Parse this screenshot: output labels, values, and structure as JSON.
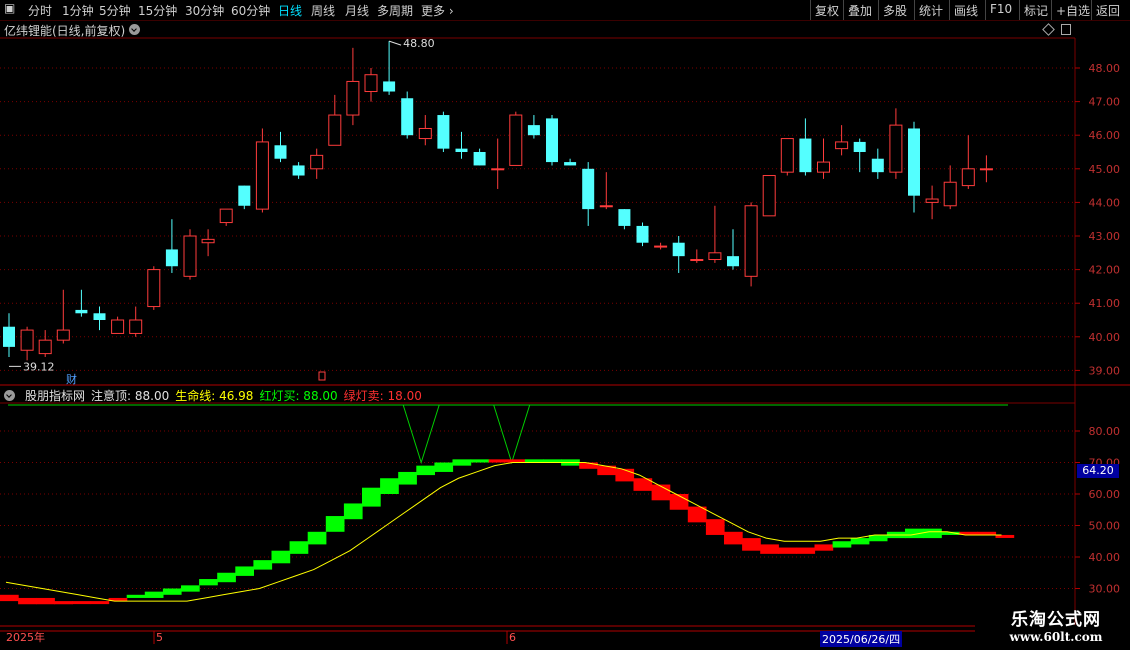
{
  "toolbar": {
    "left": [
      "分时",
      "1分钟",
      "5分钟",
      "15分钟",
      "30分钟",
      "60分钟",
      "日线",
      "周线",
      "月线",
      "多周期",
      "更多"
    ],
    "active": "日线",
    "right": [
      "复权",
      "叠加",
      "多股",
      "统计",
      "画线",
      "F10",
      "标记",
      "+自选",
      "返回"
    ]
  },
  "stock": {
    "title": "亿纬锂能(日线,前复权)",
    "high_marker": "48.80",
    "low_marker": "39.12",
    "fin_marker": "财"
  },
  "price_axis": [
    "48.00",
    "47.00",
    "46.00",
    "45.00",
    "44.00",
    "43.00",
    "42.00",
    "41.00",
    "40.00",
    "39.00"
  ],
  "indicator": {
    "name": "股朋指标网",
    "items": [
      {
        "label": "注意顶: 88.00",
        "color": "#e0e0e0"
      },
      {
        "label": "生命线: 46.98",
        "color": "#ffff00"
      },
      {
        "label": "红灯买: 88.00",
        "color": "#00ff00"
      },
      {
        "label": "绿灯卖: 18.00",
        "color": "#ff3030"
      }
    ],
    "axis": [
      "80.00",
      "70.00",
      "60.00",
      "50.00",
      "40.00",
      "30.00"
    ],
    "current_label": "64.20"
  },
  "date_axis": {
    "year": "2025年",
    "m5": "5",
    "m6": "6",
    "cursor_date": "2025/06/26/四"
  },
  "watermark": {
    "line1": "乐淘公式网",
    "line2": "www.60lt.com"
  },
  "colors": {
    "up": "#ff3c3c",
    "down": "#54ffff",
    "green": "#00ff00",
    "red": "#ff0000",
    "life": "#ffff00",
    "grid": "#7a0000"
  },
  "chart_data": {
    "type": "candlestick",
    "candles": [
      [
        40.3,
        39.7,
        40.7,
        39.4
      ],
      [
        39.6,
        40.2,
        40.3,
        39.3
      ],
      [
        39.5,
        39.9,
        40.2,
        39.4
      ],
      [
        39.9,
        40.2,
        41.4,
        39.8
      ],
      [
        40.8,
        40.7,
        41.4,
        40.6
      ],
      [
        40.7,
        40.5,
        40.9,
        40.2
      ],
      [
        40.1,
        40.5,
        40.6,
        40.1
      ],
      [
        40.1,
        40.5,
        40.9,
        40.0
      ],
      [
        40.9,
        42.0,
        42.1,
        40.8
      ],
      [
        42.6,
        42.1,
        43.5,
        41.9
      ],
      [
        41.8,
        43.0,
        43.2,
        41.7
      ],
      [
        42.8,
        42.9,
        43.2,
        42.4
      ],
      [
        43.4,
        43.8,
        43.8,
        43.3
      ],
      [
        44.5,
        43.9,
        44.5,
        43.8
      ],
      [
        43.8,
        45.8,
        46.2,
        43.7
      ],
      [
        45.7,
        45.3,
        46.1,
        45.2
      ],
      [
        45.1,
        44.8,
        45.2,
        44.7
      ],
      [
        45.0,
        45.4,
        45.6,
        44.7
      ],
      [
        45.7,
        46.6,
        47.2,
        45.7
      ],
      [
        46.6,
        47.6,
        48.6,
        46.3
      ],
      [
        47.3,
        47.8,
        48.0,
        47.0
      ],
      [
        47.6,
        47.3,
        48.8,
        47.2
      ],
      [
        47.1,
        46.0,
        47.3,
        45.9
      ],
      [
        45.9,
        46.2,
        46.6,
        45.7
      ],
      [
        46.6,
        45.6,
        46.7,
        45.5
      ],
      [
        45.6,
        45.5,
        46.1,
        45.3
      ],
      [
        45.5,
        45.1,
        45.6,
        45.1
      ],
      [
        45.0,
        45.0,
        45.9,
        44.4
      ],
      [
        45.1,
        46.6,
        46.7,
        45.1
      ],
      [
        46.3,
        46.0,
        46.6,
        45.9
      ],
      [
        46.5,
        45.2,
        46.6,
        45.1
      ],
      [
        45.2,
        45.1,
        45.3,
        45.1
      ],
      [
        45.0,
        43.8,
        45.2,
        43.3
      ],
      [
        43.9,
        43.9,
        44.9,
        43.8
      ],
      [
        43.8,
        43.3,
        43.8,
        43.2
      ],
      [
        43.3,
        42.8,
        43.4,
        42.7
      ],
      [
        42.7,
        42.7,
        42.8,
        42.6
      ],
      [
        42.8,
        42.4,
        43.0,
        41.9
      ],
      [
        42.3,
        42.3,
        42.6,
        42.2
      ],
      [
        42.3,
        42.5,
        43.9,
        42.2
      ],
      [
        42.4,
        42.1,
        43.2,
        42.0
      ],
      [
        41.8,
        43.9,
        44.0,
        41.5
      ],
      [
        43.6,
        44.8,
        44.8,
        43.6
      ],
      [
        44.9,
        45.9,
        45.9,
        44.8
      ],
      [
        45.9,
        44.9,
        46.5,
        44.8
      ],
      [
        44.9,
        45.2,
        45.9,
        44.7
      ],
      [
        45.6,
        45.8,
        46.3,
        45.4
      ],
      [
        45.8,
        45.5,
        45.9,
        44.9
      ],
      [
        45.3,
        44.9,
        45.6,
        44.7
      ],
      [
        44.9,
        46.3,
        46.8,
        44.7
      ],
      [
        46.2,
        44.2,
        46.4,
        43.7
      ],
      [
        44.0,
        44.1,
        44.5,
        43.5
      ],
      [
        43.9,
        44.6,
        45.1,
        43.8
      ],
      [
        44.5,
        45.0,
        46.0,
        44.4
      ],
      [
        45.0,
        45.0,
        45.4,
        44.6
      ]
    ],
    "indicator_blocks": [
      [
        26,
        28
      ],
      [
        25,
        27
      ],
      [
        25,
        27
      ],
      [
        25,
        26
      ],
      [
        26,
        26
      ],
      [
        26,
        26
      ],
      [
        26,
        27
      ],
      [
        27,
        28
      ],
      [
        27,
        29
      ],
      [
        28,
        30
      ],
      [
        29,
        31
      ],
      [
        31,
        33
      ],
      [
        32,
        35
      ],
      [
        34,
        37
      ],
      [
        36,
        39
      ],
      [
        38,
        42
      ],
      [
        41,
        45
      ],
      [
        44,
        48
      ],
      [
        48,
        53
      ],
      [
        52,
        57
      ],
      [
        56,
        62
      ],
      [
        60,
        65
      ],
      [
        63,
        67
      ],
      [
        66,
        69
      ],
      [
        67,
        70
      ],
      [
        69,
        71
      ],
      [
        70,
        71
      ],
      [
        70,
        71
      ],
      [
        70,
        71
      ],
      [
        70,
        71
      ],
      [
        70,
        71
      ],
      [
        69,
        71
      ],
      [
        68,
        70
      ],
      [
        66,
        69
      ],
      [
        64,
        68
      ],
      [
        61,
        65
      ],
      [
        58,
        63
      ],
      [
        55,
        60
      ],
      [
        51,
        56
      ],
      [
        47,
        52
      ],
      [
        44,
        48
      ],
      [
        42,
        46
      ],
      [
        41,
        44
      ],
      [
        41,
        43
      ],
      [
        41,
        43
      ],
      [
        42,
        44
      ],
      [
        43,
        45
      ],
      [
        44,
        46
      ],
      [
        45,
        47
      ],
      [
        46,
        48
      ],
      [
        46,
        49
      ],
      [
        46,
        49
      ],
      [
        47,
        48
      ],
      [
        47,
        48
      ],
      [
        47,
        48
      ],
      [
        47,
        47
      ]
    ],
    "indicator_colors": "rrrrrrrggggggggggggggggggggrrgggrrrrrrrrrrrrrrgggggggrrrrr",
    "life_line": [
      32,
      31,
      30,
      29,
      28,
      27,
      26,
      26,
      26,
      26,
      26,
      27,
      28,
      29,
      30,
      32,
      34,
      36,
      39,
      42,
      46,
      50,
      54,
      58,
      62,
      65,
      67,
      69,
      70,
      70,
      70,
      70,
      70,
      69,
      68,
      66,
      63,
      60,
      57,
      54,
      51,
      48,
      46,
      45,
      45,
      45,
      46,
      46,
      47,
      47,
      47,
      48,
      48,
      47,
      47,
      47
    ],
    "signals": [
      22,
      27
    ]
  }
}
